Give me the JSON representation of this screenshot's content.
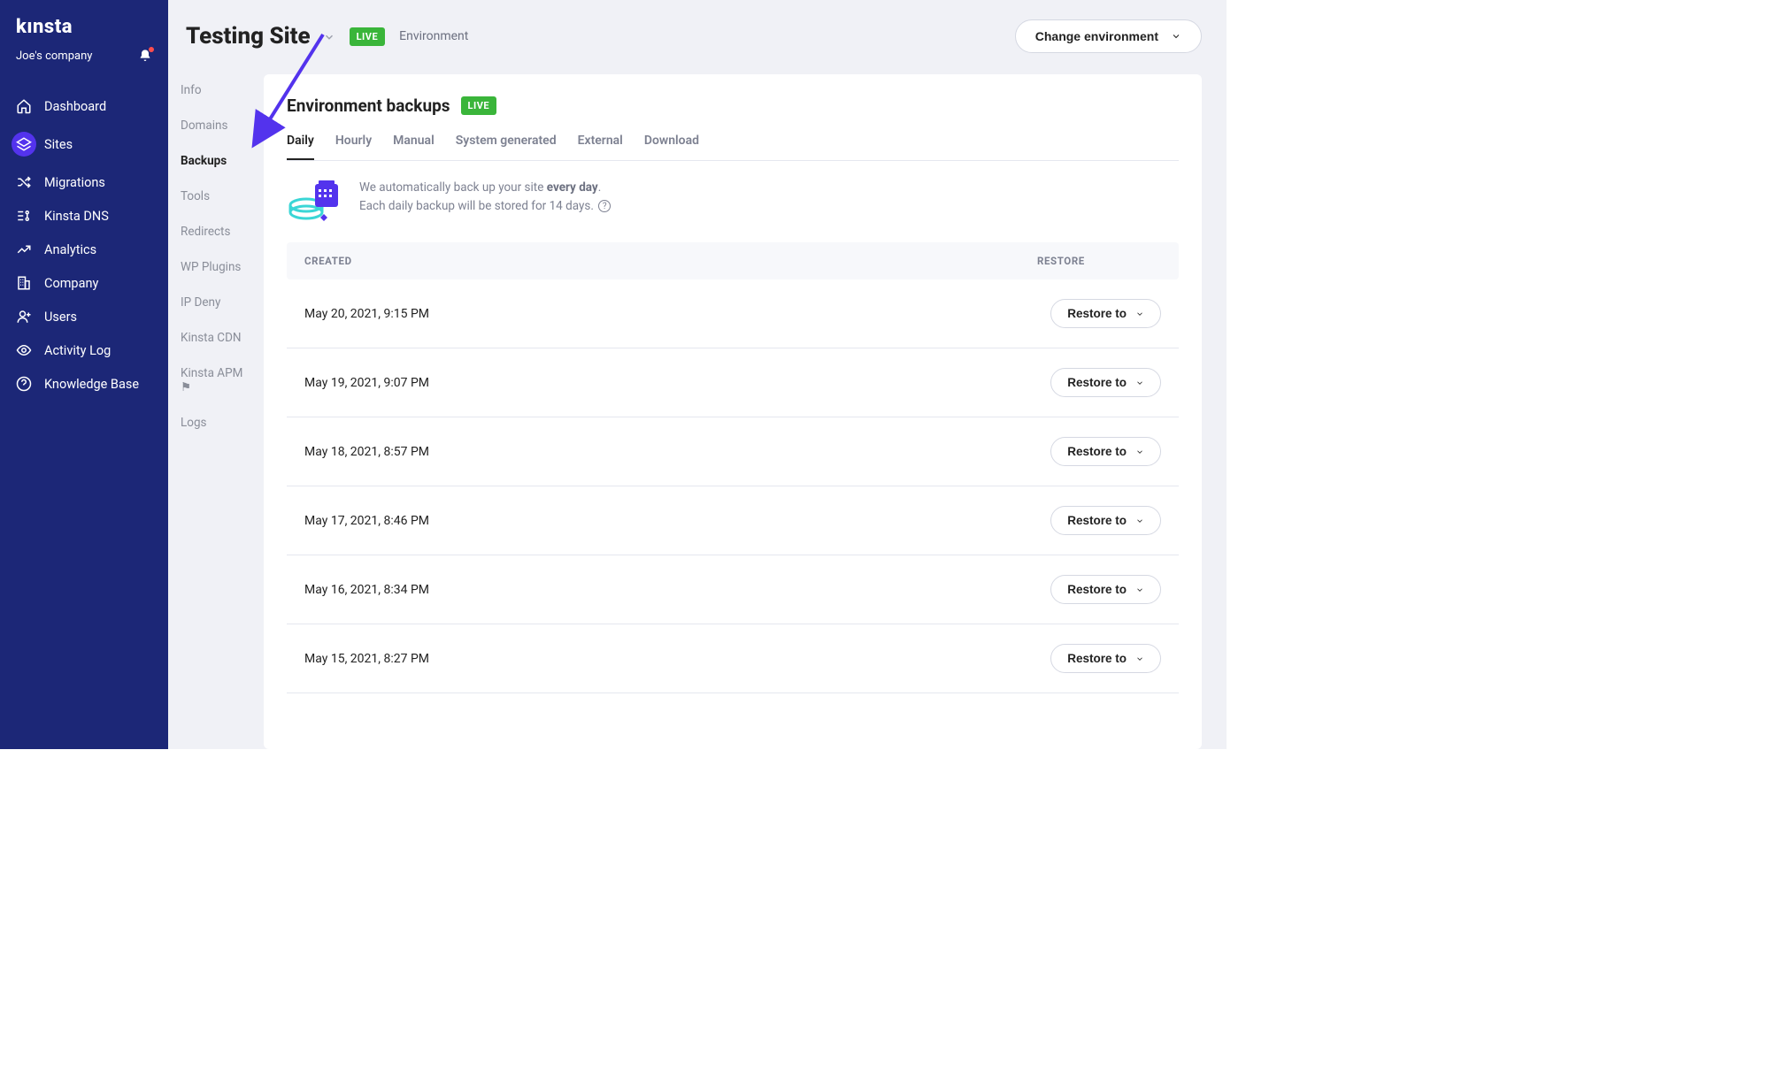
{
  "brand": "kınsta",
  "company": "Joe's company",
  "sidebar": {
    "items": [
      {
        "label": "Dashboard",
        "icon": "home"
      },
      {
        "label": "Sites",
        "icon": "layers",
        "active": true
      },
      {
        "label": "Migrations",
        "icon": "shuffle"
      },
      {
        "label": "Kinsta DNS",
        "icon": "dns"
      },
      {
        "label": "Analytics",
        "icon": "trend"
      },
      {
        "label": "Company",
        "icon": "building"
      },
      {
        "label": "Users",
        "icon": "user-plus"
      },
      {
        "label": "Activity Log",
        "icon": "eye"
      },
      {
        "label": "Knowledge Base",
        "icon": "question"
      }
    ]
  },
  "subnav": {
    "items": [
      {
        "label": "Info"
      },
      {
        "label": "Domains"
      },
      {
        "label": "Backups",
        "active": true
      },
      {
        "label": "Tools"
      },
      {
        "label": "Redirects"
      },
      {
        "label": "WP Plugins"
      },
      {
        "label": "IP Deny"
      },
      {
        "label": "Kinsta CDN"
      },
      {
        "label": "Kinsta APM ⚑"
      },
      {
        "label": "Logs"
      }
    ]
  },
  "header": {
    "site_title": "Testing Site",
    "live_badge": "LIVE",
    "env_label": "Environment",
    "change_env": "Change environment"
  },
  "panel": {
    "title": "Environment backups",
    "badge": "LIVE",
    "tabs": [
      {
        "label": "Daily",
        "active": true
      },
      {
        "label": "Hourly"
      },
      {
        "label": "Manual"
      },
      {
        "label": "System generated"
      },
      {
        "label": "External"
      },
      {
        "label": "Download"
      }
    ],
    "desc_line1_a": "We automatically back up your site ",
    "desc_line1_b": "every day",
    "desc_line1_c": ".",
    "desc_line2": "Each daily backup will be stored for 14 days.",
    "columns": {
      "created": "CREATED",
      "restore": "RESTORE"
    },
    "restore_label": "Restore to",
    "rows": [
      {
        "date": "May 20, 2021, 9:15 PM"
      },
      {
        "date": "May 19, 2021, 9:07 PM"
      },
      {
        "date": "May 18, 2021, 8:57 PM"
      },
      {
        "date": "May 17, 2021, 8:46 PM"
      },
      {
        "date": "May 16, 2021, 8:34 PM"
      },
      {
        "date": "May 15, 2021, 8:27 PM"
      }
    ]
  }
}
